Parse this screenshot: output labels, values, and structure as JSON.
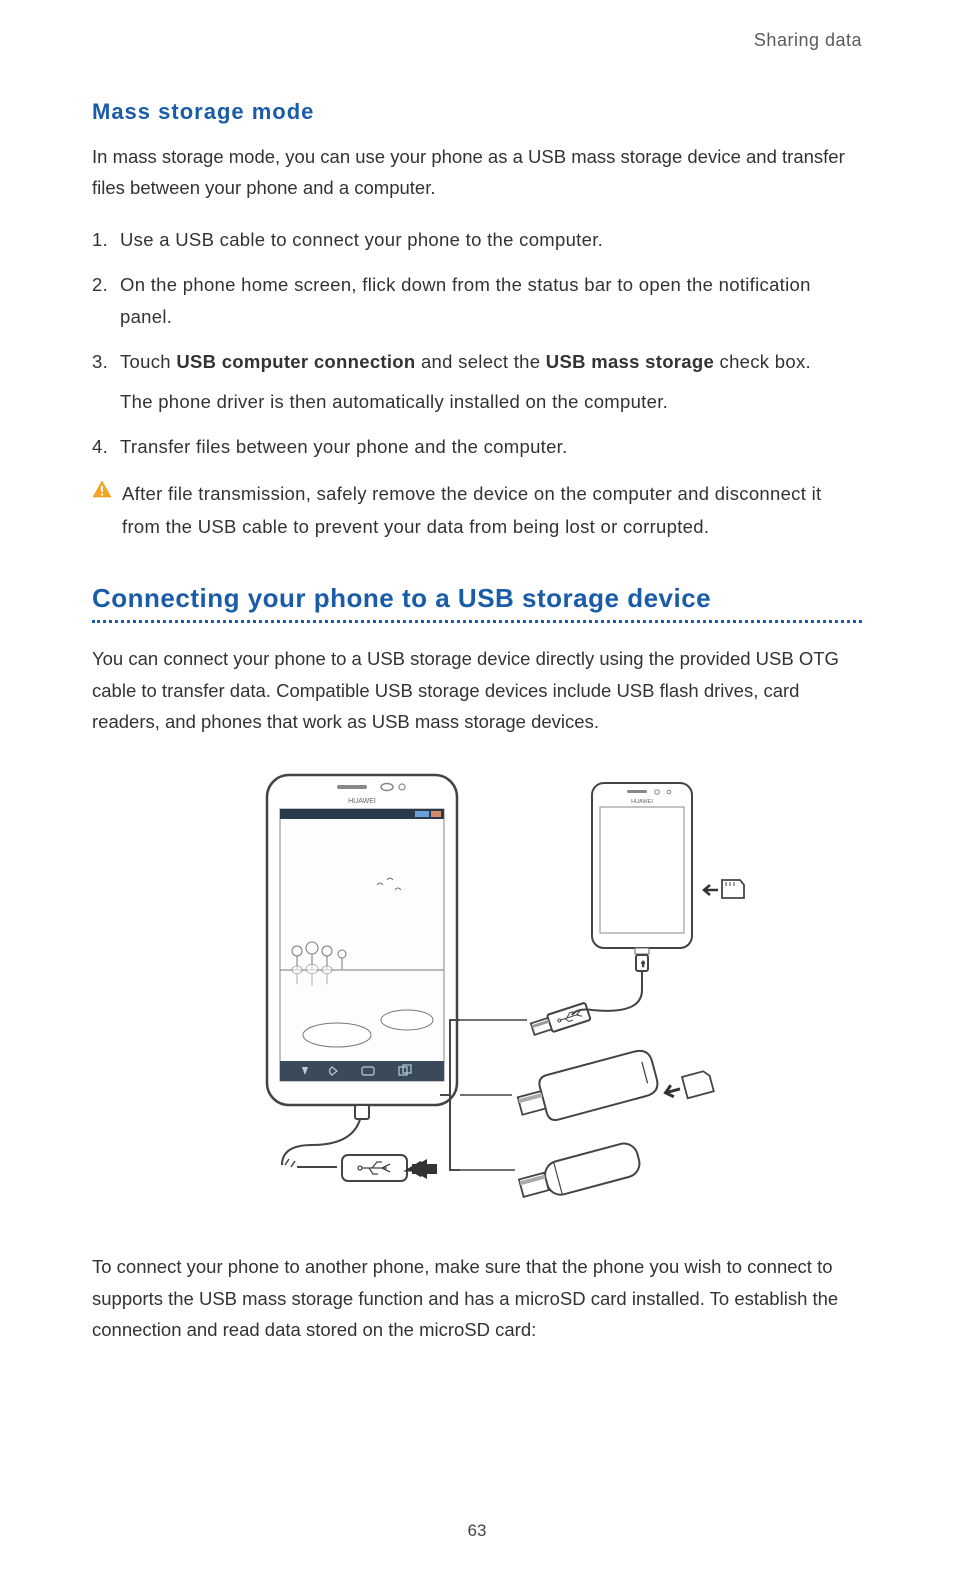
{
  "running_header": "Sharing data",
  "section1": {
    "heading": "Mass  storage  mode",
    "intro": "In mass storage mode, you can use your phone as a USB mass storage device and transfer files between your phone and a computer.",
    "steps": [
      {
        "text": "Use a USB cable to connect your phone to the computer."
      },
      {
        "text": "On the phone home screen, flick down from the status bar to open the notification panel."
      },
      {
        "pre": "Touch ",
        "bold1": "USB computer connection",
        "mid": " and select the ",
        "bold2": "USB mass storage",
        "post": " check box.",
        "sub": "The phone driver is then automatically installed on the computer."
      },
      {
        "text": "Transfer files between your phone and the computer."
      }
    ],
    "caution": "After file transmission, safely remove the device on the computer and disconnect it from the USB cable to prevent your data from being lost or corrupted."
  },
  "section2": {
    "heading": "Connecting your phone to a USB storage device",
    "intro": "You can connect your phone to a USB storage device directly using the provided USB OTG cable to transfer data. Compatible USB storage devices include USB flash drives, card readers, and phones that work as USB mass storage devices.",
    "outro": "To connect your phone to another phone, make sure that the phone you wish to connect to supports the USB mass storage function and has a microSD card installed. To establish the connection and read data stored on the microSD card:"
  },
  "page_number": "63",
  "illustration": {
    "phone_brand": "HUAWEI"
  }
}
